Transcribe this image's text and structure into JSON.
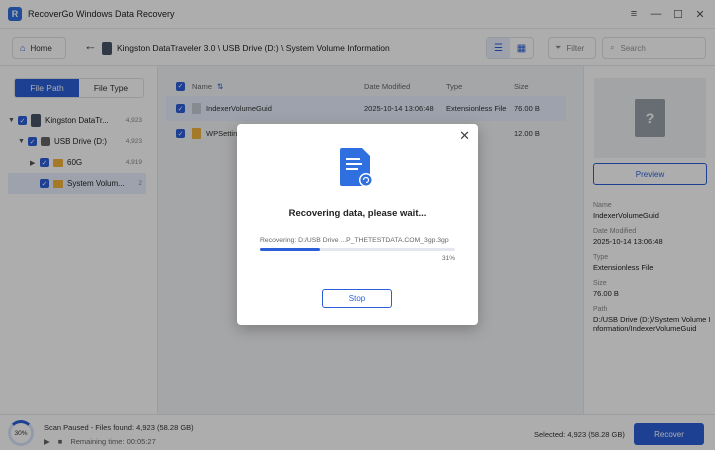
{
  "app": {
    "title": "RecoverGo Windows Data Recovery",
    "logo_letter": "R"
  },
  "window_controls": [
    "menu-icon",
    "minimize-icon",
    "maximize-icon",
    "close-icon"
  ],
  "toolbar": {
    "home_label": "Home",
    "path": "Kingston DataTraveler 3.0 \\ USB Drive (D:) \\ System Volume Information",
    "filter_label": "Filter",
    "search_placeholder": "Search"
  },
  "sidebar": {
    "tabs": [
      {
        "label": "File Path",
        "active": true
      },
      {
        "label": "File Type",
        "active": false
      }
    ],
    "tree": [
      {
        "label": "Kingston DataTr...",
        "count": "4,923"
      },
      {
        "label": "USB Drive (D:)",
        "count": "4,923"
      },
      {
        "label": "60G",
        "count": "4,919"
      },
      {
        "label": "System Volum...",
        "count": "2"
      }
    ]
  },
  "table": {
    "columns": {
      "name": "Name",
      "date": "Date Modified",
      "type": "Type",
      "size": "Size"
    },
    "rows": [
      {
        "name": "IndexerVolumeGuid",
        "date": "2025-10-14 13:06:48",
        "type": "Extensionless File",
        "size": "76.00 B"
      },
      {
        "name": "WPSettings",
        "date": "",
        "type": "",
        "size": "12.00 B"
      }
    ]
  },
  "details": {
    "preview_label": "Preview",
    "fields": [
      {
        "label": "Name",
        "value": "IndexerVolumeGuid"
      },
      {
        "label": "Date Modified",
        "value": "2025-10-14 13:06:48"
      },
      {
        "label": "Type",
        "value": "Extensionless File"
      },
      {
        "label": "Size",
        "value": "76.00 B"
      },
      {
        "label": "Path",
        "value": "D:/USB Drive (D:)/System Volume Information/IndexerVolumeGuid"
      }
    ]
  },
  "status": {
    "scan_percent": "30%",
    "scan_text": "Scan Paused - Files found: 4,923 (58.28 GB)",
    "remaining": "Remaining time: 00:05:27",
    "selected": "Selected: 4,923 (58.28 GB)",
    "recover_label": "Recover"
  },
  "modal": {
    "title": "Recovering data, please wait...",
    "path": "Recovering: D:/USB Drive ...P_THETESTDATA.COM_3gp.3gp",
    "percent": "31%",
    "progress": 0.31,
    "stop_label": "Stop"
  },
  "colors": {
    "accent": "#2b5fd9",
    "folder": "#f2b43b"
  }
}
